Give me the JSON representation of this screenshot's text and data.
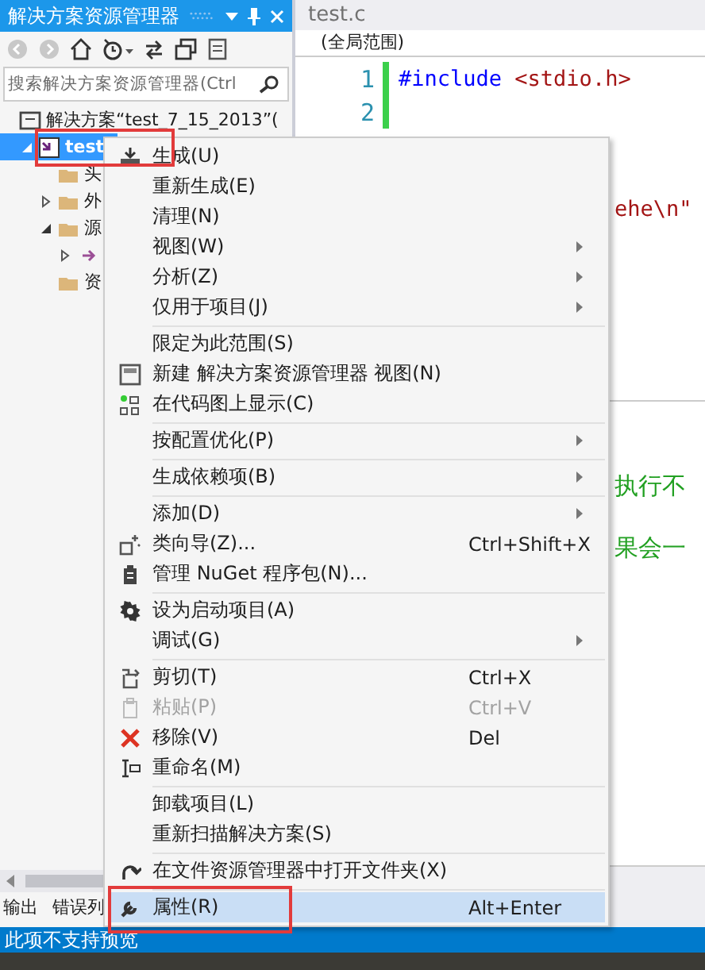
{
  "explorer": {
    "title": "解决方案资源管理器",
    "search": {
      "placeholder": "搜索解决方案资源管理器(Ctrl"
    },
    "tree": [
      {
        "label": "解决方案“test_7_15_2013”(",
        "kind": "solution",
        "selected": false,
        "children": [
          {
            "label": "test",
            "kind": "project",
            "selected": true,
            "expanded": true,
            "children": [
              {
                "label": "头",
                "kind": "folder",
                "selected": false
              },
              {
                "label": "外",
                "kind": "folder",
                "selected": false,
                "expanded": false
              },
              {
                "label": "源",
                "kind": "folder",
                "selected": false,
                "expanded": true,
                "children": [
                  {
                    "kind": "file",
                    "selected": false,
                    "expanded": false
                  }
                ]
              },
              {
                "label": "资",
                "kind": "folder",
                "selected": false
              }
            ]
          }
        ]
      }
    ],
    "bottom_tabs": [
      {
        "label": "输出",
        "selected": false
      },
      {
        "label": "错误列",
        "selected": false
      }
    ]
  },
  "editor": {
    "tab": "test.c",
    "scope": "(全局范围)",
    "lines": [
      {
        "number": "1",
        "code": "#include <stdio.h>"
      },
      {
        "number": "2"
      }
    ],
    "peek_code": "ehe\\n\"",
    "output_lines": [
      "执行不",
      "果会一"
    ]
  },
  "context_menu": [
    {
      "label": "生成(U)",
      "selected": false
    },
    {
      "label": "重新生成(E)",
      "selected": false
    },
    {
      "label": "清理(N)",
      "selected": false
    },
    {
      "label": "视图(W)",
      "submenu": true,
      "selected": false
    },
    {
      "label": "分析(Z)",
      "submenu": true,
      "selected": false
    },
    {
      "label": "仅用于项目(J)",
      "submenu": true,
      "selected": false
    },
    {
      "kind": "separator"
    },
    {
      "label": "限定为此范围(S)",
      "selected": false
    },
    {
      "label": "新建 解决方案资源管理器 视图(N)",
      "selected": false
    },
    {
      "label": "在代码图上显示(C)",
      "selected": false
    },
    {
      "kind": "separator"
    },
    {
      "label": "按配置优化(P)",
      "submenu": true,
      "selected": false
    },
    {
      "kind": "separator"
    },
    {
      "label": "生成依赖项(B)",
      "submenu": true,
      "selected": false
    },
    {
      "kind": "separator"
    },
    {
      "label": "添加(D)",
      "submenu": true,
      "selected": false
    },
    {
      "label": "类向导(Z)...",
      "shortcut": "Ctrl+Shift+X",
      "selected": false
    },
    {
      "label": "管理 NuGet 程序包(N)...",
      "selected": false
    },
    {
      "kind": "separator"
    },
    {
      "label": "设为启动项目(A)",
      "selected": false
    },
    {
      "label": "调试(G)",
      "submenu": true,
      "selected": false
    },
    {
      "kind": "separator"
    },
    {
      "label": "剪切(T)",
      "shortcut": "Ctrl+X",
      "selected": false
    },
    {
      "label": "粘贴(P)",
      "shortcut": "Ctrl+V",
      "disabled": true,
      "selected": false
    },
    {
      "label": "移除(V)",
      "shortcut": "Del",
      "selected": false
    },
    {
      "label": "重命名(M)",
      "selected": false
    },
    {
      "kind": "separator"
    },
    {
      "label": "卸载项目(L)",
      "selected": false
    },
    {
      "label": "重新扫描解决方案(S)",
      "selected": false
    },
    {
      "kind": "separator"
    },
    {
      "label": "在文件资源管理器中打开文件夹(X)",
      "selected": false
    },
    {
      "kind": "separator"
    },
    {
      "label": "属性(R)",
      "shortcut": "Alt+Enter",
      "selected": true
    }
  ],
  "status_bar": "此项不支持预览"
}
